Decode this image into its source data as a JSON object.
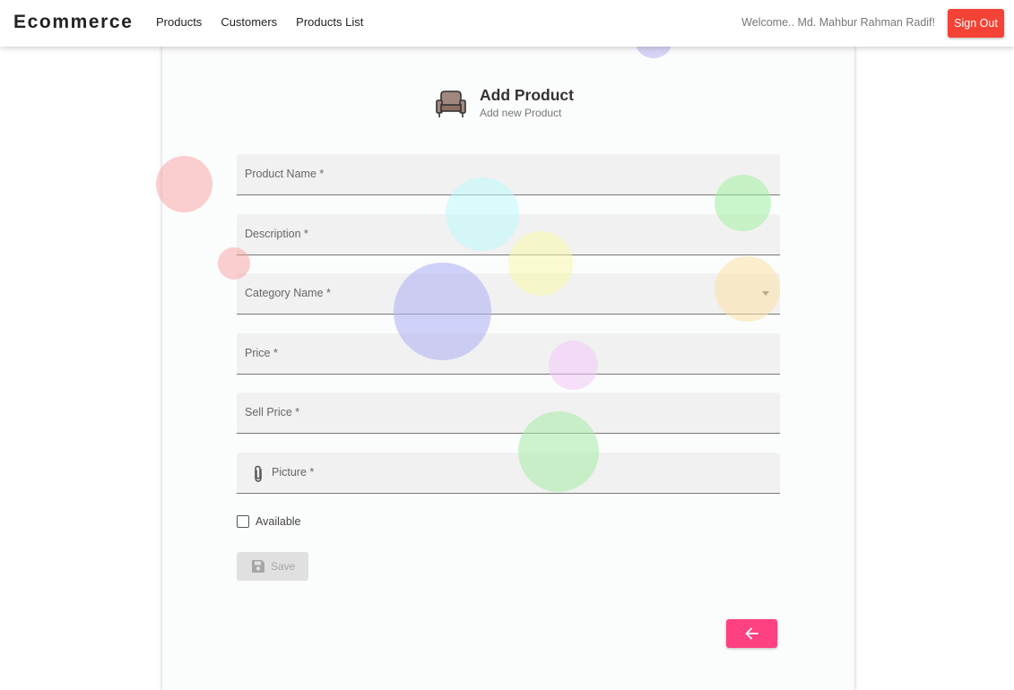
{
  "navbar": {
    "brand": "Ecommerce",
    "links": [
      "Products",
      "Customers",
      "Products List"
    ],
    "welcome": "Welcome.. Md. Mahbur Rahman Radif!",
    "signout_label": "Sign Out"
  },
  "form": {
    "title": "Add Product",
    "subtitle": "Add new Product",
    "fields": {
      "product_name": "Product Name *",
      "description": "Description *",
      "category_name": "Category Name *",
      "price": "Price *",
      "sell_price": "Sell Price *",
      "picture": "Picture *"
    },
    "available_label": "Available",
    "available_checked": false,
    "save_label": "Save"
  },
  "colors": {
    "signout": "#f44336",
    "back_button": "#ff4081",
    "field_bg": "#f1f1f1",
    "save_disabled_bg": "#e0e0e0"
  },
  "icons": {
    "header": "armchair-icon",
    "picture": "paperclip-icon",
    "save": "floppy-disk-icon",
    "back": "arrow-left-icon",
    "category": "dropdown-caret-icon"
  }
}
